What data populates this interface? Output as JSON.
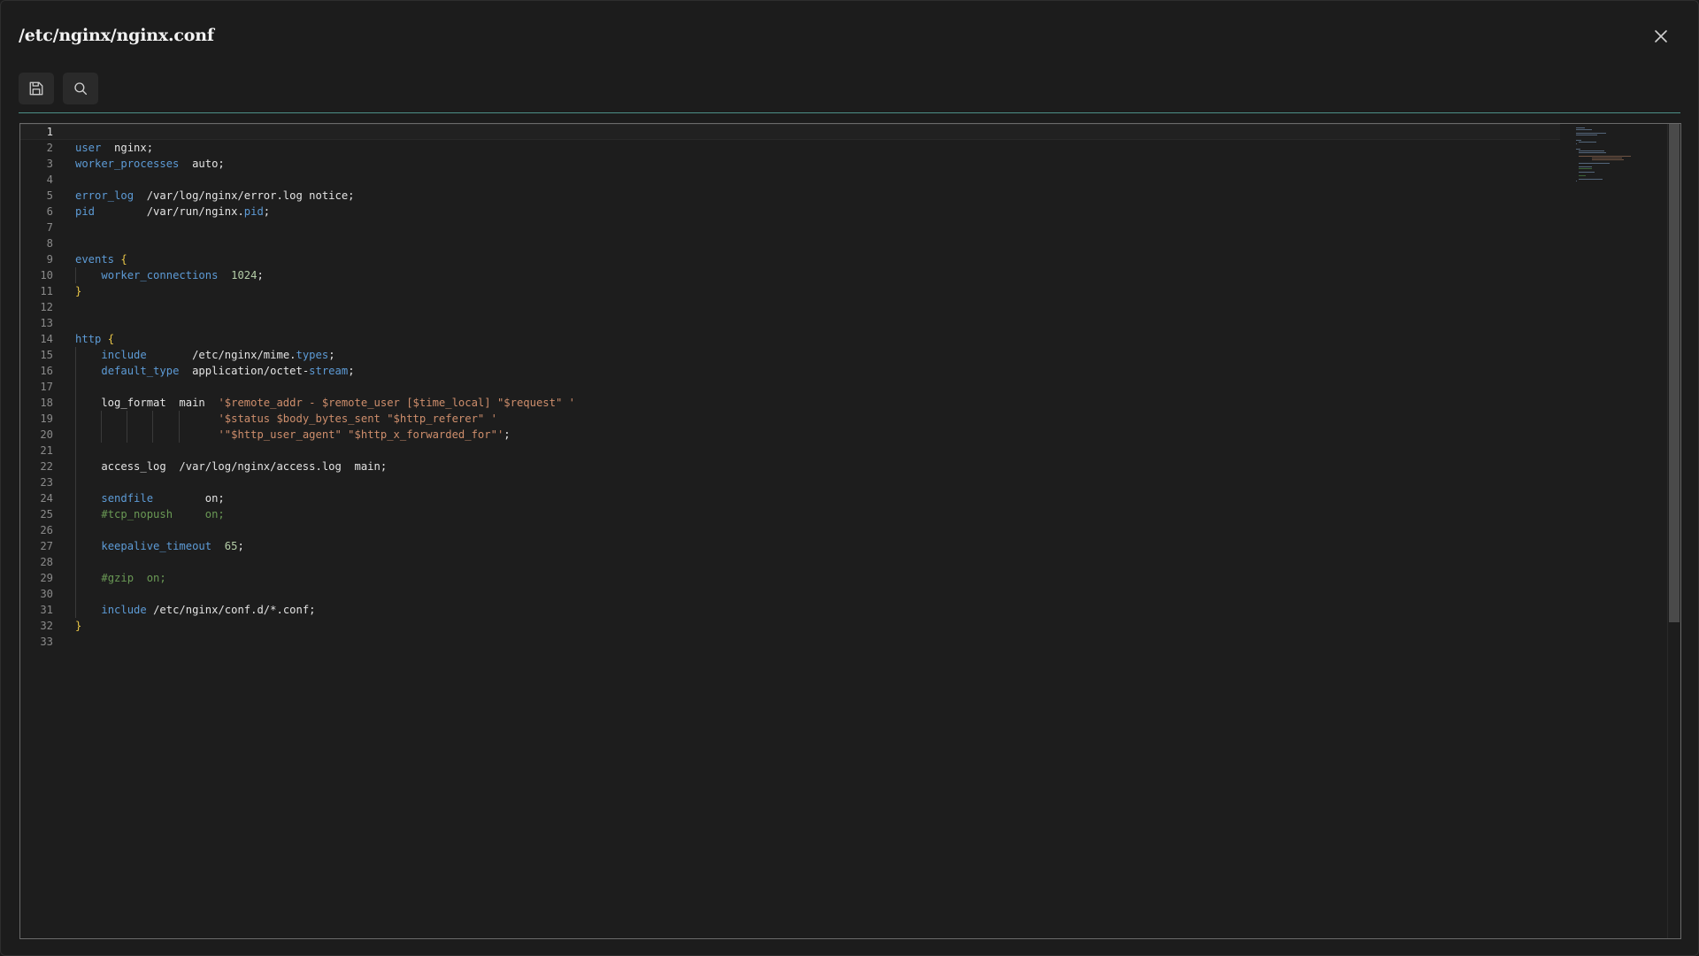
{
  "window": {
    "title": "/etc/nginx/nginx.conf",
    "close_icon": "close-icon"
  },
  "toolbar": {
    "buttons": [
      {
        "name": "save-button",
        "icon": "save-icon"
      },
      {
        "name": "search-button",
        "icon": "search-icon"
      }
    ]
  },
  "editor": {
    "current_line": 1,
    "lines": [
      "",
      "user  nginx;",
      "worker_processes  auto;",
      "",
      "error_log  /var/log/nginx/error.log notice;",
      "pid        /var/run/nginx.pid;",
      "",
      "",
      "events {",
      "    worker_connections  1024;",
      "}",
      "",
      "",
      "http {",
      "    include       /etc/nginx/mime.types;",
      "    default_type  application/octet-stream;",
      "",
      "    log_format  main  '$remote_addr - $remote_user [$time_local] \"$request\" '",
      "                      '$status $body_bytes_sent \"$http_referer\" '",
      "                      '\"$http_user_agent\" \"$http_x_forwarded_for\"';",
      "",
      "    access_log  /var/log/nginx/access.log  main;",
      "",
      "    sendfile        on;",
      "    #tcp_nopush     on;",
      "",
      "    keepalive_timeout  65;",
      "",
      "    #gzip  on;",
      "",
      "    include /etc/nginx/conf.d/*.conf;",
      "}",
      ""
    ]
  },
  "colors": {
    "keyword": "#5d9bd6",
    "string": "#ce8e6c",
    "number": "#b5cea8",
    "comment": "#6a9955",
    "brace": "#e8c547",
    "accent_divider": "#4c8f88"
  }
}
